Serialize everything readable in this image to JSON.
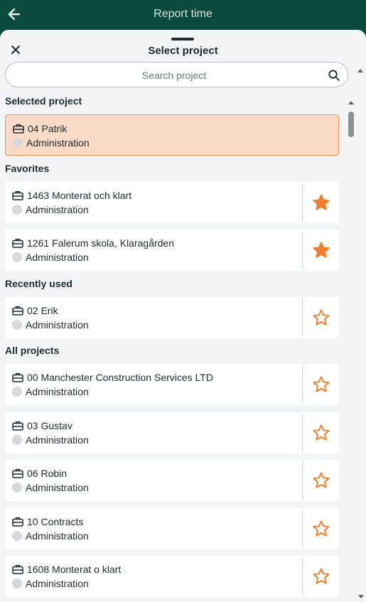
{
  "header": {
    "title": "Report time",
    "back_icon": "arrow-left-icon"
  },
  "sheet": {
    "title": "Select project",
    "close_icon": "close-icon",
    "search": {
      "placeholder": "Search project",
      "value": ""
    }
  },
  "colors": {
    "header_bg": "#0b4a3f",
    "accent": "#f2944f",
    "selected_bg": "#fadbc8",
    "star": "#f47c2a"
  },
  "sections": {
    "selected": "Selected project",
    "favorites": "Favorites",
    "recent": "Recently used",
    "all": "All projects"
  },
  "selected_project": {
    "name": "04 Patrik",
    "activity": "Administration"
  },
  "favorites": [
    {
      "name": "1463 Monterat och klart",
      "activity": "Administration",
      "favorite": true
    },
    {
      "name": "1261 Falerum skola, Klaragården",
      "activity": "Administration",
      "favorite": true
    }
  ],
  "recent": [
    {
      "name": "02 Erik",
      "activity": "Administration",
      "favorite": false
    }
  ],
  "all": [
    {
      "name": "00 Manchester Construction Services LTD",
      "activity": "Administration",
      "favorite": false
    },
    {
      "name": "03 Gustav",
      "activity": "Administration",
      "favorite": false
    },
    {
      "name": "06 Robin",
      "activity": "Administration",
      "favorite": false
    },
    {
      "name": "10 Contracts",
      "activity": "Administration",
      "favorite": false
    },
    {
      "name": "1608 Monterat o klart",
      "activity": "Administration",
      "favorite": false
    }
  ]
}
